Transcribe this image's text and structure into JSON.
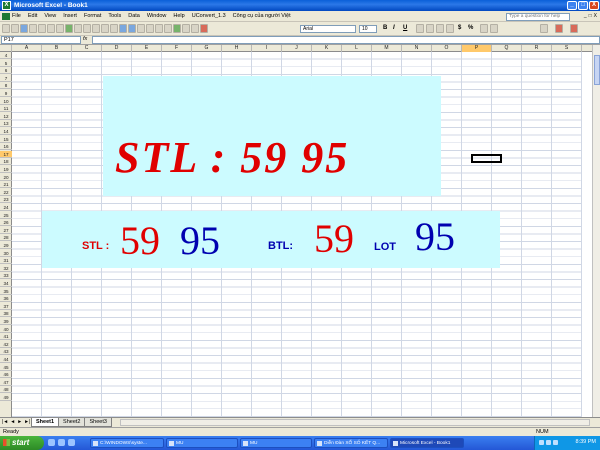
{
  "window": {
    "title": "Microsoft Excel - Book1",
    "minimize": "_",
    "maximize": "□",
    "close": "X"
  },
  "menu": {
    "items": [
      "File",
      "Edit",
      "View",
      "Insert",
      "Format",
      "Tools",
      "Data",
      "Window",
      "Help",
      "UConvert_1.3",
      "Công cụ của người Việt"
    ],
    "help_placeholder": "Type a question for help",
    "doc_controls": [
      "_",
      "□",
      "X"
    ]
  },
  "toolbar": {
    "font": "Arial",
    "size": "10",
    "bold": "B",
    "italic": "I",
    "underline": "U",
    "currency": "$",
    "percent": "%"
  },
  "formula_bar": {
    "name_box": "P17",
    "fx": "fx",
    "value": ""
  },
  "columns": [
    "A",
    "B",
    "C",
    "D",
    "E",
    "F",
    "G",
    "H",
    "I",
    "J",
    "K",
    "L",
    "M",
    "N",
    "O",
    "P",
    "Q",
    "R",
    "S"
  ],
  "selected_column": "P",
  "rows": [
    "4",
    "5",
    "6",
    "7",
    "8",
    "9",
    "10",
    "11",
    "12",
    "13",
    "14",
    "15",
    "16",
    "17",
    "18",
    "19",
    "20",
    "21",
    "22",
    "23",
    "24",
    "25",
    "26",
    "27",
    "28",
    "29",
    "30",
    "31",
    "32",
    "33",
    "34",
    "35",
    "36",
    "37",
    "38",
    "39",
    "40",
    "41",
    "42",
    "43",
    "44",
    "45",
    "46",
    "47",
    "48",
    "49"
  ],
  "selected_row": "17",
  "sheet": {
    "banner1_text": "STL  :  59  95",
    "banner2": {
      "stl_label": "STL :",
      "stl_num1": "59",
      "stl_num2": "95",
      "btl_label": "BTL:",
      "btl_num": "59",
      "lot_label": "LOT",
      "lot_num": "95"
    },
    "colors": {
      "banner_bg": "#ccfbff",
      "red": "#e00000",
      "blue": "#0000b0"
    }
  },
  "tabs": {
    "nav": [
      "|◄",
      "◄",
      "►",
      "►|"
    ],
    "sheets": [
      "Sheet1",
      "Sheet2",
      "Sheet3"
    ],
    "active": "Sheet1"
  },
  "status": {
    "left": "Ready",
    "num": "NUM"
  },
  "taskbar": {
    "start": "start",
    "buttons": [
      "C:\\WINDOWS\\syste...",
      "MU",
      "MU",
      "Diễn Đàn XỔ SỐ KẾT Q...",
      "Microsoft Excel - Book1"
    ],
    "active_index": 4,
    "clock": "8:39 PM"
  }
}
